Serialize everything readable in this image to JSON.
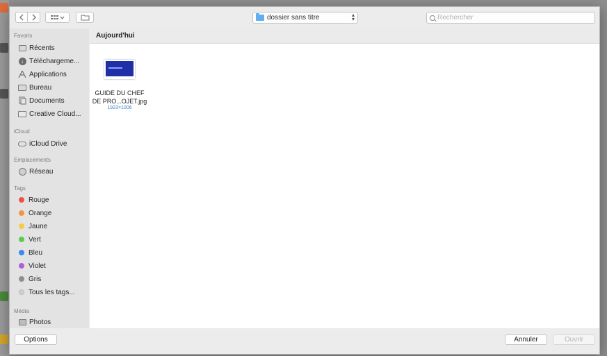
{
  "toolbar": {
    "back_icon": "chevron-left-icon",
    "forward_icon": "chevron-right-icon",
    "view_icon": "icon-grid-view-icon",
    "new_folder_icon": "new-folder-icon",
    "path_folder": "dossier sans titre",
    "search_placeholder": "Rechercher"
  },
  "sidebar": {
    "sections": {
      "favorites": "Favoris",
      "icloud": "iCloud",
      "locations": "Emplacements",
      "tags": "Tags",
      "media": "Média"
    },
    "favorites": [
      {
        "label": "Récents",
        "icon": "recents-icon"
      },
      {
        "label": "Téléchargeme...",
        "icon": "downloads-icon"
      },
      {
        "label": "Applications",
        "icon": "applications-icon"
      },
      {
        "label": "Bureau",
        "icon": "desktop-icon"
      },
      {
        "label": "Documents",
        "icon": "documents-icon"
      },
      {
        "label": "Creative Cloud...",
        "icon": "folder-icon"
      }
    ],
    "icloud": [
      {
        "label": "iCloud Drive",
        "icon": "cloud-icon"
      }
    ],
    "locations": [
      {
        "label": "Réseau",
        "icon": "network-icon"
      }
    ],
    "tags": [
      {
        "label": "Rouge",
        "color": "#f0504a"
      },
      {
        "label": "Orange",
        "color": "#f5943c"
      },
      {
        "label": "Jaune",
        "color": "#f7cc44"
      },
      {
        "label": "Vert",
        "color": "#5cc94f"
      },
      {
        "label": "Bleu",
        "color": "#3d89f0"
      },
      {
        "label": "Violet",
        "color": "#b15fd6"
      },
      {
        "label": "Gris",
        "color": "#8e8e8e"
      },
      {
        "label": "Tous les tags...",
        "color": "#d0d0d0"
      }
    ],
    "media": [
      {
        "label": "Photos",
        "icon": "photos-icon"
      }
    ]
  },
  "main": {
    "section_title": "Aujourd'hui",
    "files": [
      {
        "name_line1": "GUIDE DU CHEF",
        "name_line2": "DE PRO...OJET.jpg",
        "dimensions": "1923×1006"
      }
    ]
  },
  "buttons": {
    "options": "Options",
    "cancel": "Annuler",
    "open": "Ouvrir"
  }
}
